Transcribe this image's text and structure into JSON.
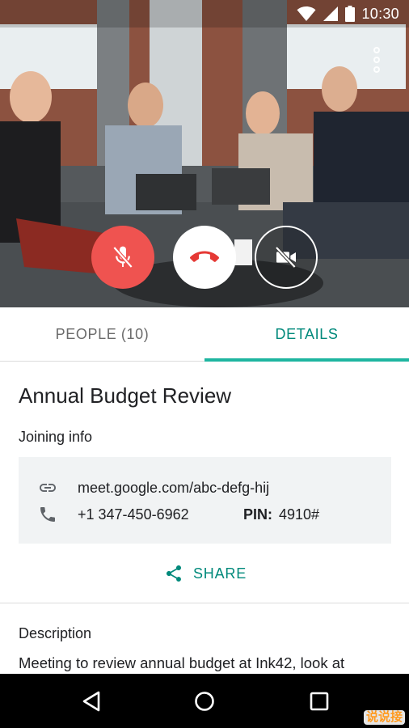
{
  "status_bar": {
    "time": "10:30",
    "icons": [
      "wifi-icon",
      "cell-signal-icon",
      "battery-icon"
    ]
  },
  "call": {
    "controls": [
      {
        "name": "mute-microphone",
        "icon": "mic-off-icon",
        "state": "muted",
        "color": "#ef5350"
      },
      {
        "name": "end-call",
        "icon": "call-end-icon",
        "color": "#e53935"
      },
      {
        "name": "toggle-camera",
        "icon": "videocam-off-icon",
        "state": "off"
      }
    ],
    "overflow_icon": "more-vert-icon"
  },
  "tabs": [
    {
      "label": "PEOPLE (10)",
      "selected": false
    },
    {
      "label": "DETAILS",
      "selected": true
    }
  ],
  "details": {
    "title": "Annual Budget Review",
    "joining_info_label": "Joining info",
    "link": "meet.google.com/abc-defg-hij",
    "phone": "+1 347-450-6962",
    "pin_label": "PIN:",
    "pin_value": "4910#",
    "share_label": "SHARE",
    "description_label": "Description",
    "description_text": "Meeting to review annual budget at Ink42, look at"
  },
  "colors": {
    "accent": "#00897b",
    "tab_indicator": "#1eb5a0",
    "mute_red": "#ef5350"
  },
  "watermark": "说说接"
}
